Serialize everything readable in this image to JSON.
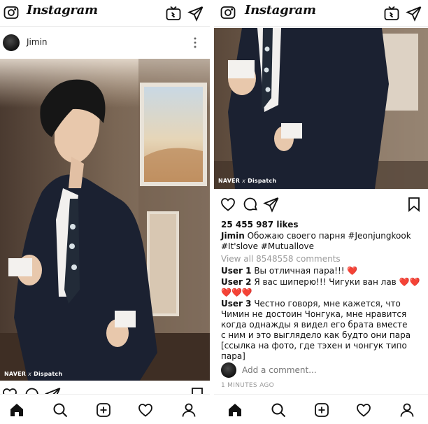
{
  "app": {
    "name": "Instagram"
  },
  "left": {
    "username": "Jimin",
    "watermark": {
      "brand": "NAVER",
      "partner": "Dispatch"
    }
  },
  "right": {
    "watermark": {
      "brand": "NAVER",
      "partner": "Dispatch"
    },
    "likes": "25 455 987 likes",
    "caption": {
      "author": "Jimin",
      "line1": "Обожаю своего парня #Jeonjungkook",
      "line2": "#It'slove #Mutuallove"
    },
    "view_comments": "View all 8548558 comments",
    "comments": [
      {
        "user": "User 1",
        "line1": "Вы отличная пара!!!",
        "hearts_line1": "❤️"
      },
      {
        "user": "User 2",
        "line1": "Я вас шиперю!!! Чигуки ван лав",
        "hearts_line1": "❤️❤️❤️",
        "hearts_line2": "❤️❤️❤️"
      },
      {
        "user": "User 3",
        "line1": "Честно говоря, мне кажется, что",
        "line2": "Чимин не достоин Чонгука, мне нравится",
        "line3": "когда однажды я видел его брата вместе",
        "line4": "с ним и это выглядело как будто они пара",
        "line5": "[ссылка на фото, где тэхен и чонгук типо",
        "line6": "пара]"
      }
    ],
    "add_comment_placeholder": "Add a comment...",
    "timestamp": "1 MINUTES AGO"
  },
  "icons": {
    "camera": "camera-icon",
    "igtv": "igtv-icon",
    "direct": "direct-message-icon",
    "more": "more-options-icon",
    "like": "heart-icon",
    "comment": "comment-icon",
    "share": "share-icon",
    "save": "bookmark-icon",
    "home": "home-icon",
    "search": "search-icon",
    "add": "add-post-icon",
    "activity": "activity-heart-icon",
    "profile": "profile-icon"
  },
  "colors": {
    "heart": "#e0182a",
    "muted": "#9a9a9a",
    "divider": "#e6e6e6"
  }
}
